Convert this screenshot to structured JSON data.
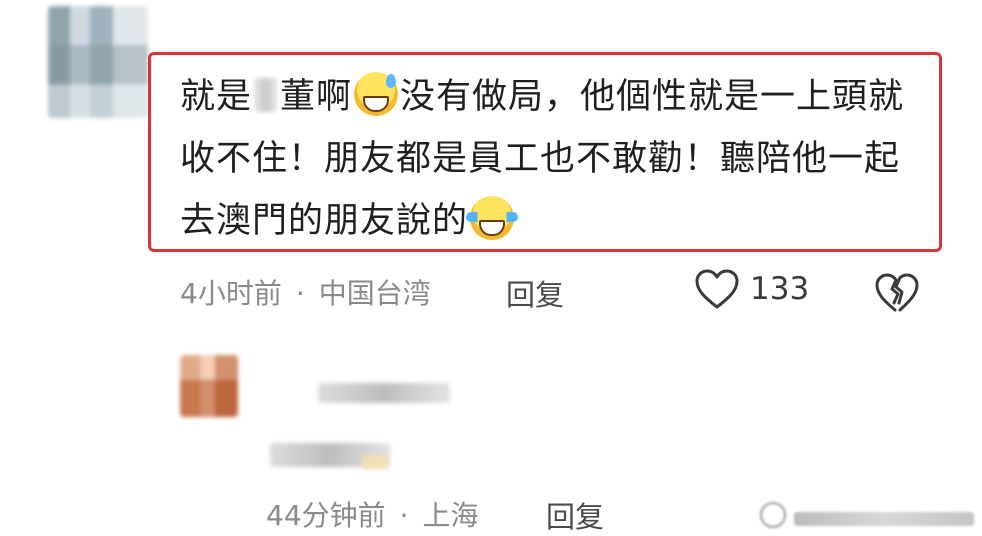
{
  "comment_1": {
    "text_part_1": "就是",
    "text_part_2": "董啊",
    "text_part_3": "没有做局，他個性就是一上頭就收不住！朋友都是員工也不敢勸！聽陪他一起去澳門的朋友說的",
    "time": "4小时前",
    "separator": "·",
    "location": "中国台湾",
    "reply_label": "回复",
    "like_count": "133",
    "emoji_1": "grinning-sweat-emoji",
    "emoji_2": "tears-of-joy-emoji"
  },
  "comment_2": {
    "time": "44分钟前",
    "separator": "·",
    "location": "上海",
    "reply_label": "回复"
  },
  "colors": {
    "highlight_border": "#d8343b",
    "meta_text": "#8a8a8a"
  },
  "icons": {
    "like": "heart-outline-icon",
    "dislike": "broken-heart-icon"
  }
}
